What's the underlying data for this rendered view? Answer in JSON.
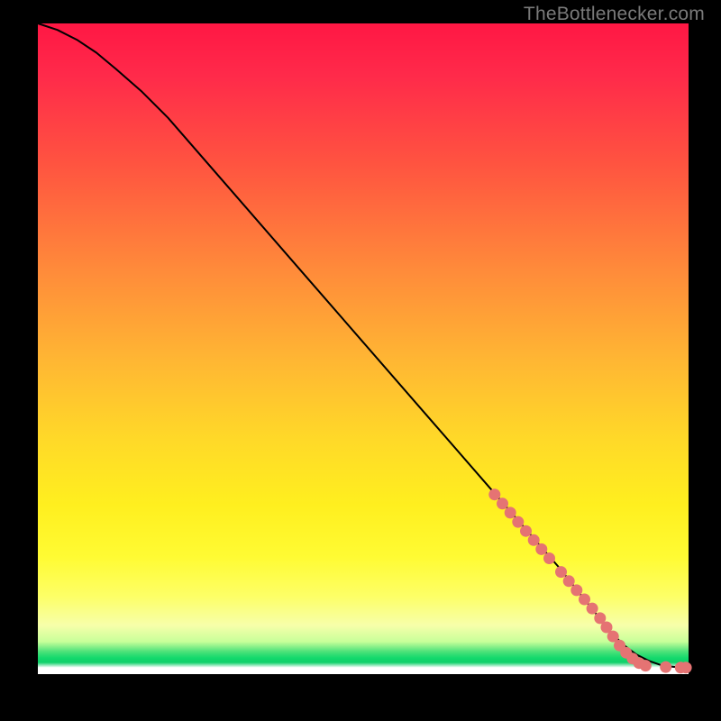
{
  "branding": "TheBottlenecker.com",
  "chart_data": {
    "type": "line",
    "title": "",
    "xlabel": "",
    "ylabel": "",
    "xlim": [
      0,
      100
    ],
    "ylim": [
      0,
      100
    ],
    "series": [
      {
        "name": "curve",
        "x": [
          0,
          3,
          6,
          9,
          12,
          16,
          20,
          30,
          40,
          50,
          60,
          70,
          80,
          84,
          86,
          88,
          90,
          92,
          94,
          96,
          98,
          100
        ],
        "y": [
          100,
          99,
          97.5,
          95.5,
          93,
          89.5,
          85.5,
          74,
          62.5,
          51,
          39.5,
          28,
          16.5,
          11.5,
          9,
          6.5,
          4.5,
          3,
          2,
          1.3,
          1.1,
          1
        ]
      }
    ],
    "marker_points": [
      {
        "x": 70.2,
        "y": 27.6
      },
      {
        "x": 71.4,
        "y": 26.2
      },
      {
        "x": 72.6,
        "y": 24.8
      },
      {
        "x": 73.8,
        "y": 23.4
      },
      {
        "x": 75.0,
        "y": 22.0
      },
      {
        "x": 76.2,
        "y": 20.6
      },
      {
        "x": 77.4,
        "y": 19.2
      },
      {
        "x": 78.6,
        "y": 17.8
      },
      {
        "x": 80.4,
        "y": 15.7
      },
      {
        "x": 81.6,
        "y": 14.3
      },
      {
        "x": 82.8,
        "y": 12.9
      },
      {
        "x": 84.0,
        "y": 11.5
      },
      {
        "x": 85.2,
        "y": 10.1
      },
      {
        "x": 86.4,
        "y": 8.6
      },
      {
        "x": 87.4,
        "y": 7.2
      },
      {
        "x": 88.4,
        "y": 5.8
      },
      {
        "x": 89.4,
        "y": 4.4
      },
      {
        "x": 90.4,
        "y": 3.3
      },
      {
        "x": 91.4,
        "y": 2.4
      },
      {
        "x": 92.4,
        "y": 1.7
      },
      {
        "x": 93.4,
        "y": 1.3
      },
      {
        "x": 96.5,
        "y": 1.1
      },
      {
        "x": 98.8,
        "y": 1.0
      },
      {
        "x": 99.6,
        "y": 1.0
      }
    ],
    "marker_color": "#e57373",
    "curve_color": "#000000"
  }
}
